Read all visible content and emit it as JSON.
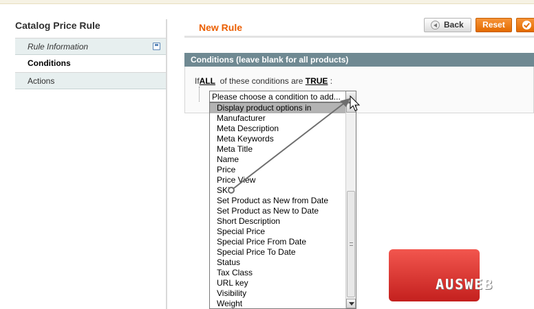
{
  "sidebar": {
    "title": "Catalog Price Rule",
    "tabs": [
      {
        "label": "Rule Information"
      },
      {
        "label": "Conditions"
      },
      {
        "label": "Actions"
      }
    ]
  },
  "header": {
    "title": "New Rule",
    "back_label": "Back",
    "reset_label": "Reset"
  },
  "conditions": {
    "section_title": "Conditions (leave blank for all products)",
    "prefix": "If",
    "aggregator": "ALL",
    "middle": "of these conditions are",
    "value": "TRUE",
    "suffix": ":",
    "select_value": "Please choose a condition to add...",
    "options": [
      "Display product options in",
      "Manufacturer",
      "Meta Description",
      "Meta Keywords",
      "Meta Title",
      "Name",
      "Price",
      "Price View",
      "SKU",
      "Set Product as New from Date",
      "Set Product as New to Date",
      "Short Description",
      "Special Price",
      "Special Price From Date",
      "Special Price To Date",
      "Status",
      "Tax Class",
      "URL key",
      "Visibility",
      "Weight"
    ]
  },
  "logo": {
    "text": "AUSWEB"
  },
  "colors": {
    "accent": "#eb5e00",
    "section_header": "#6f8992",
    "button_orange": "#e46b00",
    "logo_red": "#d83a33"
  }
}
